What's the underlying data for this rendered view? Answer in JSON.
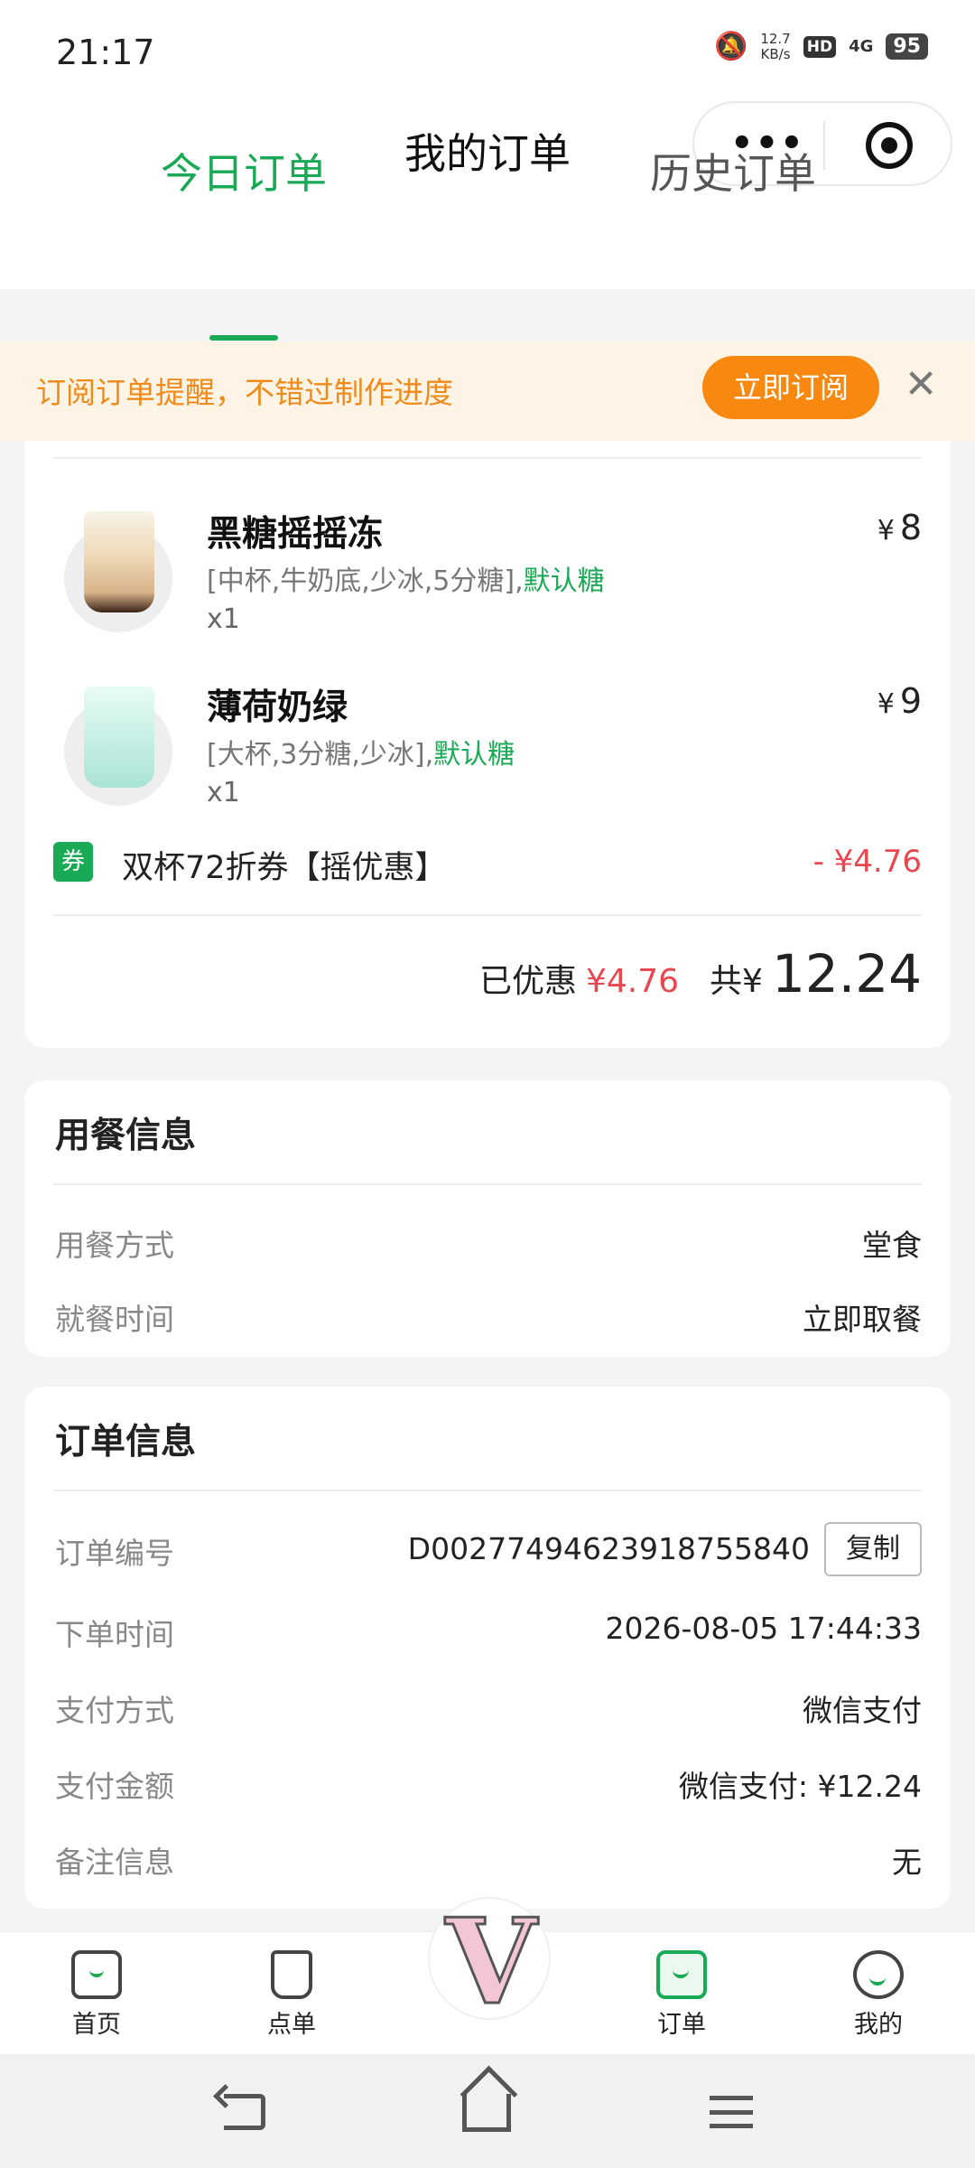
{
  "status_bar": {
    "time": "21:17",
    "net_speed_value": "12.7",
    "net_speed_unit": "KB/s",
    "hd": "HD",
    "network": "4G",
    "battery": "95"
  },
  "header": {
    "title": "我的订单"
  },
  "tabs": [
    {
      "label": "今日订单",
      "active": true
    },
    {
      "label": "历史订单",
      "active": false
    }
  ],
  "notice": {
    "text": "订阅订单提醒，不错过制作进度",
    "button": "立即订阅",
    "close": "✕"
  },
  "items": [
    {
      "name": "黑糖摇摇冻",
      "spec": "[中杯,牛奶底,少冰,5分糖],",
      "sugar": "默认糖",
      "qty": "x1",
      "currency": "¥",
      "price": "8"
    },
    {
      "name": "薄荷奶绿",
      "spec": "[大杯,3分糖,少冰],",
      "sugar": "默认糖",
      "qty": "x1",
      "currency": "¥",
      "price": "9"
    }
  ],
  "coupon": {
    "badge": "券",
    "name": "双杯72折券【摇优惠】",
    "amount": "- ¥4.76"
  },
  "summary": {
    "saved_label": "已优惠",
    "saved_amount": "¥4.76",
    "total_label": "共¥",
    "total_amount": "12.24"
  },
  "dining": {
    "title": "用餐信息",
    "rows": [
      {
        "label": "用餐方式",
        "value": "堂食"
      },
      {
        "label": "就餐时间",
        "value": "立即取餐"
      }
    ]
  },
  "order": {
    "title": "订单信息",
    "order_no_label": "订单编号",
    "order_no": "D0027749462391875584​0",
    "copy": "复制",
    "rows": [
      {
        "label": "下单时间",
        "value": "2026-08-05 17:44:33"
      },
      {
        "label": "支付方式",
        "value": "微信支付"
      },
      {
        "label": "支付金额",
        "value": "微信支付: ¥12.24"
      },
      {
        "label": "备注信息",
        "value": "无"
      }
    ]
  },
  "tabbar": [
    {
      "label": "首页",
      "icon": "home-icon"
    },
    {
      "label": "点单",
      "icon": "cup-icon"
    },
    {
      "label": "订单",
      "icon": "order-bag-icon",
      "active": true
    },
    {
      "label": "我的",
      "icon": "profile-icon"
    }
  ],
  "center_logo": "V",
  "colors": {
    "accent_green": "#1aaa55",
    "notice_orange": "#f8880f",
    "discount_red": "#e8474f"
  }
}
